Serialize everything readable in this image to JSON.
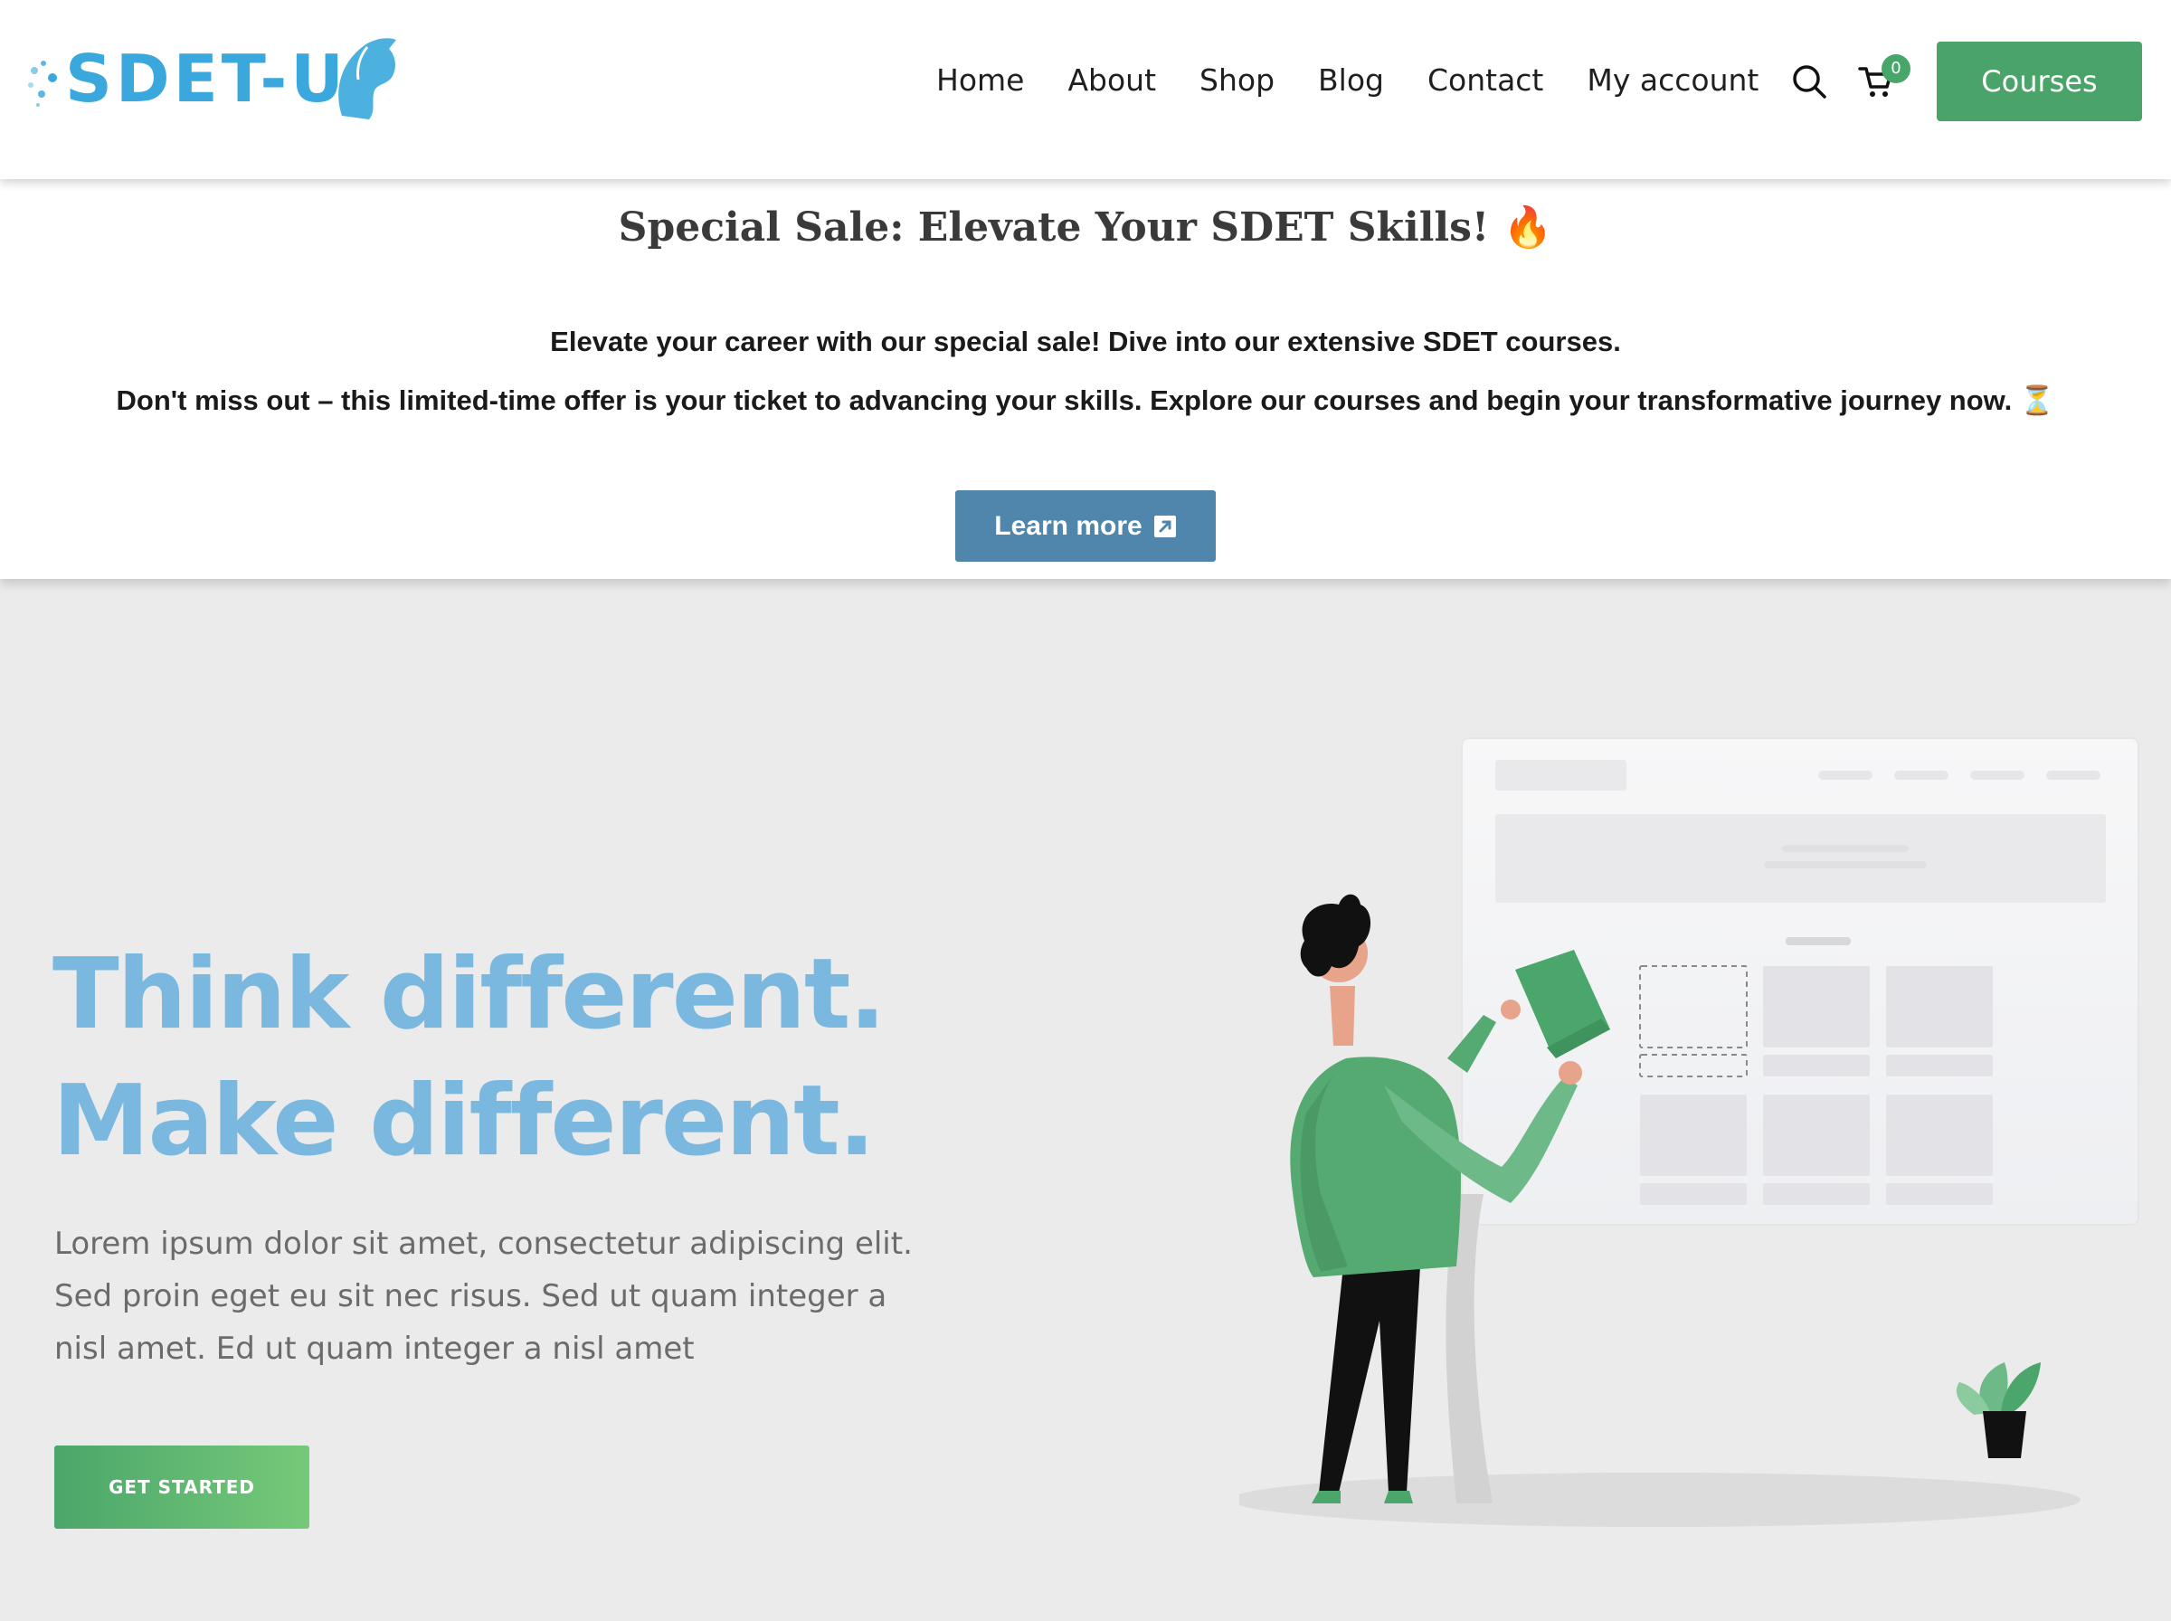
{
  "header": {
    "logo_text": "SDET-U",
    "nav": [
      "Home",
      "About",
      "Shop",
      "Blog",
      "Contact",
      "My account"
    ],
    "cart_count": "0",
    "courses_label": "Courses"
  },
  "promo": {
    "title": "Special Sale: Elevate Your SDET Skills! 🔥",
    "line1": "Elevate your career with our special sale! Dive into our extensive SDET courses.",
    "line2": "Don't miss out – this limited-time offer is your ticket to advancing your skills. Explore our courses and begin your transformative journey now. ⏳",
    "button_label": "Learn more"
  },
  "hero": {
    "title_line1": "Think different.",
    "title_line2": "Make different.",
    "body": "Lorem ipsum dolor sit amet, consectetur adipiscing elit. Sed proin eget eu sit nec risus. Sed ut quam integer a nisl amet.  Ed ut quam integer a nisl amet",
    "cta_label": "GET STARTED"
  },
  "colors": {
    "accent_green": "#4aa46a",
    "promo_button": "#5086ab",
    "hero_title": "#7ab8df",
    "background": "#ebebeb"
  },
  "icons": [
    "search-icon",
    "cart-icon",
    "external-link-icon"
  ]
}
